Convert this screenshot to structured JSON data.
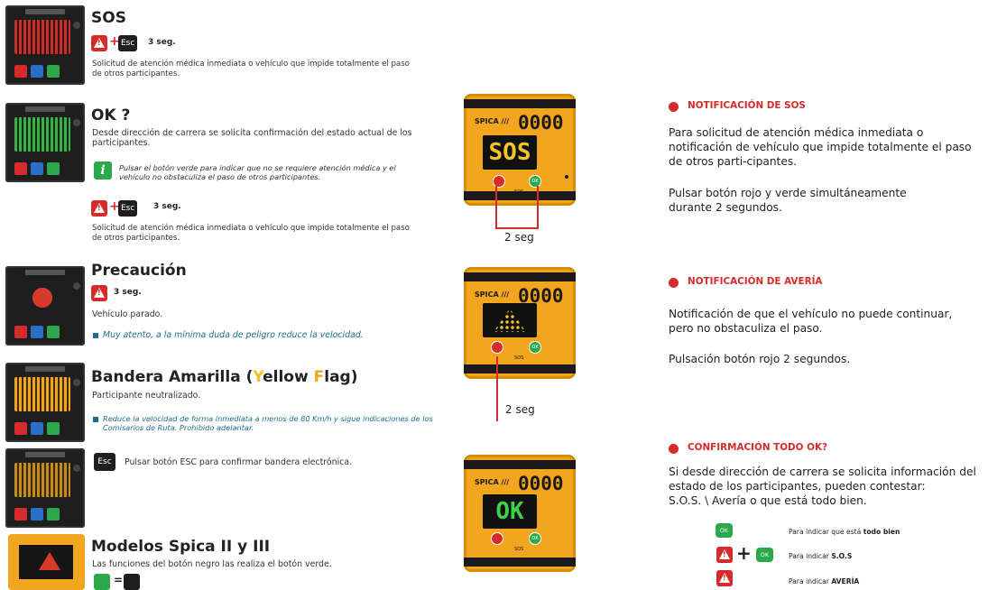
{
  "left": {
    "sos": {
      "title": "SOS",
      "combo_key": "Esc",
      "combo_time": "3 seg.",
      "desc": "Solicitud de atención médica inmediata o vehículo que impide totalmente el paso de otros participantes."
    },
    "ok": {
      "title": "OK ?",
      "desc": "Desde dirección de carrera se solicita confirmación del estado actual de los participantes.",
      "info_icon_text": "i",
      "info_text": "Pulsar el botón verde para indicar que no se requiere atención médica y el vehículo no obstaculiza el paso de otros participantes.",
      "combo_key": "Esc",
      "combo_time": "3 seg.",
      "combo_desc": "Solicitud de atención médica inmediata o vehículo que impide totalmente el paso de otros participantes."
    },
    "precaucion": {
      "title": "Precaución",
      "combo_time": "3 seg.",
      "desc": "Vehículo parado.",
      "note": "Muy atento, a la mínima duda de peligro reduce la velocidad."
    },
    "bandera": {
      "title_pre": "Bandera Amarilla (",
      "title_y": "Y",
      "title_mid": "ellow ",
      "title_f": "F",
      "title_post": "lag)",
      "desc": "Participante neutralizado.",
      "note": "Reduce la velocidad de forma inmediata a menos de 80 Km/h y sigue indicaciones de los Comisarios de Ruta. Prohibido adelantar.",
      "esc_key": "Esc",
      "esc_text": "Pulsar botón ESC para confirmar bandera electrónica."
    },
    "modelos": {
      "title": "Modelos Spica II y III",
      "desc": "Las funciones del botón negro las realiza el botón verde.",
      "eq": "="
    }
  },
  "middle": {
    "brand": "SPICA ///",
    "number": "0000",
    "screens": [
      "SOS",
      "",
      "OK"
    ],
    "ok_label": "OK",
    "sos_label": "SOS",
    "hold_1": "2 seg",
    "hold_2": "2 seg"
  },
  "right": {
    "sos": {
      "heading": "NOTIFICACIÓN DE SOS",
      "p1": "Para solicitud de atención médica inmediata o notificación de vehículo que impide totalmente el paso de otros parti-cipantes.",
      "p2": "Pulsar botón rojo y verde simultáneamente durante 2 segundos."
    },
    "averia": {
      "heading": "NOTIFICACIÓN DE AVERÍA",
      "p1": "Notificación de que el vehículo no puede continuar, pero no obstaculiza el paso.",
      "p2": "Pulsación botón rojo 2 segundos."
    },
    "confirm": {
      "heading": "CONFIRMACIÓN TODO OK?",
      "p1": "Si desde dirección de carrera se solicita información del estado de los participantes, pueden contestar:",
      "p2": "S.O.S. \\ Avería o que está todo bien.",
      "legend": [
        {
          "pre": "Para indicar que está ",
          "bold": "todo bien"
        },
        {
          "pre": "Para indicar ",
          "bold": "S.O.S"
        },
        {
          "pre": "Para indicar ",
          "bold": "AVERÍA"
        }
      ],
      "ok_label": "OK",
      "plus": "+"
    }
  },
  "colors": {
    "red": "#d62b2b",
    "green": "#2aa84a",
    "amber": "#f2a51f",
    "blue": "#1f6c8f"
  }
}
